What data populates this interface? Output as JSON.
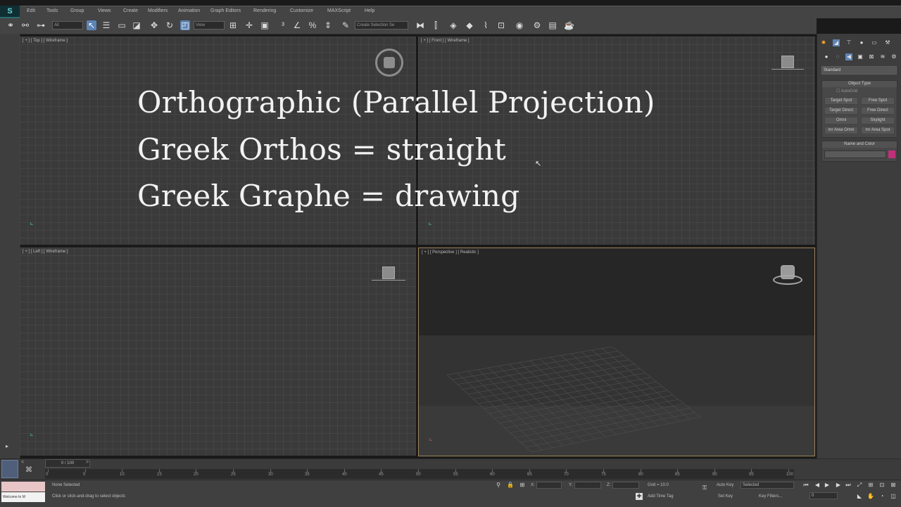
{
  "app": {
    "logo": "S"
  },
  "menu": [
    "Edit",
    "Tools",
    "Group",
    "Views",
    "Create",
    "Modifiers",
    "Animation",
    "Graph Editors",
    "Rendering",
    "Customize",
    "MAXScript",
    "Help"
  ],
  "toolbar": {
    "selection_filter": "All",
    "reference_coord": "View",
    "named_selection": "Create Selection Se",
    "icons": [
      "link-icon",
      "unlink-icon",
      "bind-icon",
      "selection-filter",
      "select-icon",
      "select-by-name-icon",
      "rect-region-icon",
      "window-crossing-icon",
      "move-icon",
      "rotate-icon",
      "scale-icon",
      "coord-system",
      "pivot-icon",
      "move-snap-icon",
      "keyboard-icon",
      "snap-3d-icon",
      "angle-snap-icon",
      "percent-snap-icon",
      "spinner-snap-icon",
      "edit-named-icon",
      "named-selection",
      "mirror-icon",
      "align-icon",
      "layer-manager-icon",
      "graphite-icon",
      "curve-editor-icon",
      "schematic-icon",
      "material-editor-icon",
      "render-setup-icon",
      "render-frame-icon",
      "render-icon"
    ]
  },
  "viewports": {
    "top": {
      "label": "[ + ] [ Top ] [ Wireframe ]"
    },
    "front": {
      "label": "[ + ] [ Front ] [ Wireframe ]"
    },
    "left": {
      "label": "[ + ] [ Left ] [ Wireframe ]"
    },
    "perspective": {
      "label": "[ + ] [ Perspective ] [ Realistic ]"
    }
  },
  "overlay": {
    "line1": "Orthographic (Parallel Projection)",
    "line2": "Greek Orthos = straight",
    "line3": "Greek Graphe = drawing"
  },
  "command_panel": {
    "dropdown": "Standard",
    "object_type_title": "Object Type",
    "autogrid": "AutoGrid",
    "buttons": [
      "Target Spot",
      "Free Spot",
      "Target Direct",
      "Free Direct",
      "Omni",
      "Skylight",
      "mr Area Omni",
      "mr Area Spot"
    ],
    "name_color_title": "Name and Color",
    "swatch_color": "#c0307a"
  },
  "timeline": {
    "frame_counter": "0 / 100",
    "ticks": [
      "0",
      "5",
      "10",
      "15",
      "20",
      "25",
      "30",
      "35",
      "40",
      "45",
      "50",
      "55",
      "60",
      "65",
      "70",
      "75",
      "80",
      "85",
      "90",
      "95",
      "100"
    ]
  },
  "status": {
    "script_label": "Welcome to M",
    "selection": "None Selected",
    "prompt": "Click or click-and-drag to select objects",
    "x_label": "X:",
    "y_label": "Y:",
    "z_label": "Z:",
    "grid": "Grid = 10.0",
    "auto_key": "Auto Key",
    "auto_key_mode": "Selected",
    "set_key": "Set Key",
    "key_filters": "Key Filters...",
    "add_time_tag": "Add Time Tag",
    "frame": "0"
  }
}
